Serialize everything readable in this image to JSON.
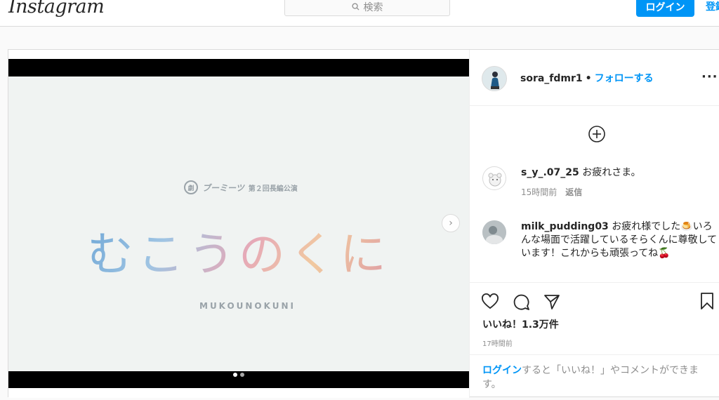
{
  "topbar": {
    "logo": "Instagram",
    "search_placeholder": "検索",
    "login_label": "ログイン",
    "signup_label": "登録"
  },
  "media": {
    "troupe_name": "ブーミーツ",
    "troupe_sub": "第２回長編公演",
    "title_jp": "むこうのくに",
    "title_roman": "MUKOUNOKUNI",
    "slides_total": 2,
    "slide_active": 1
  },
  "post": {
    "username": "sora_fdmr1",
    "separator": "•",
    "follow_label": "フォローする",
    "likes": "いいね！1.3万件",
    "time": "17時間前"
  },
  "comments": [
    {
      "user": "s_y_.07_25",
      "text": "お疲れさま。",
      "time": "15時間前",
      "reply": "返信"
    },
    {
      "user": "milk_pudding03",
      "text": "お疲れ様でした🍮いろんな場面で活躍しているそらくんに尊敬しています！これからも頑張ってね🍒"
    }
  ],
  "login_prompt": {
    "link": "ログイン",
    "text": "すると「いいね！」やコメントができます。"
  },
  "colors": {
    "accent": "#0095f6",
    "border": "#dbdbdb",
    "muted": "#8e8e8e"
  },
  "icons": [
    "search-icon",
    "chevron-right-icon",
    "more-icon",
    "add-comment-icon",
    "heart-icon",
    "comment-icon",
    "share-icon",
    "bookmark-icon"
  ]
}
